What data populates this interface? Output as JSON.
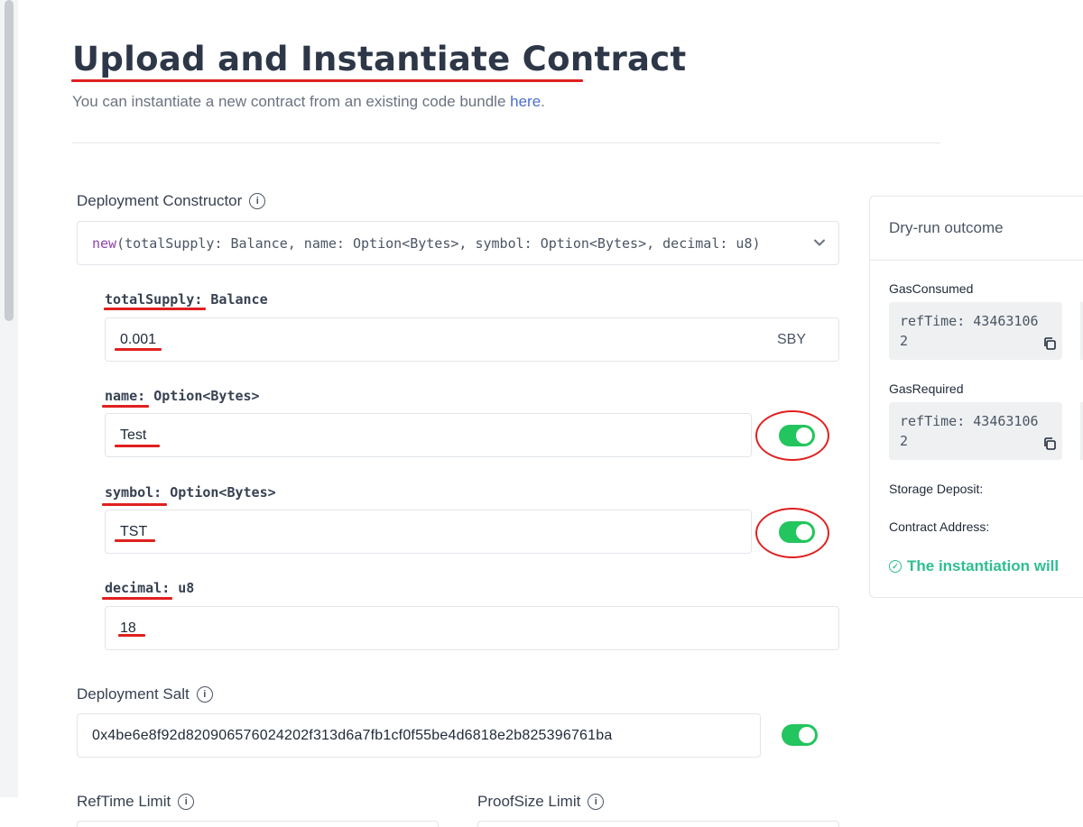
{
  "page": {
    "title": "Upload and Instantiate Contract",
    "subtitle_prefix": "You can instantiate a new contract from an existing code bundle ",
    "subtitle_link": "here",
    "subtitle_suffix": "."
  },
  "constructor": {
    "label": "Deployment Constructor",
    "selected_keyword": "new",
    "selected_signature": "(totalSupply: Balance, name: Option<Bytes>, symbol: Option<Bytes>, decimal: u8)"
  },
  "params": [
    {
      "name": "totalSupply:",
      "type": "Balance",
      "value": "0.001",
      "unit": "SBY"
    },
    {
      "name": "name:",
      "type": "Option<Bytes>",
      "value": "Test",
      "toggle_on": true
    },
    {
      "name": "symbol:",
      "type": "Option<Bytes>",
      "value": "TST",
      "toggle_on": true
    },
    {
      "name": "decimal:",
      "type": "u8",
      "value": "18"
    }
  ],
  "salt": {
    "label": "Deployment Salt",
    "value": "0x4be6e8f92d820906576024202f313d6a7fb1cf0f55be4d6818e2b825396761ba",
    "toggle_on": true
  },
  "limits": {
    "reftime_label": "RefTime Limit",
    "proofsize_label": "ProofSize Limit"
  },
  "dry_run": {
    "title": "Dry-run outcome",
    "gas_consumed_label": "GasConsumed",
    "gas_consumed_line1": "refTime: 43463106",
    "gas_consumed_line2": "2",
    "gas_required_label": "GasRequired",
    "gas_required_line1": "refTime: 43463106",
    "gas_required_line2": "2",
    "storage_deposit_label": "Storage Deposit:",
    "contract_address_label": "Contract Address:",
    "success_message": "The instantiation will"
  },
  "colors": {
    "annotation_red": "#e02020",
    "toggle_green": "#22c55e",
    "success_green": "#2ebf91",
    "link_blue": "#4c6fd1"
  },
  "icons": {
    "info": "info-circle-icon",
    "chevron": "chevron-down-icon",
    "copy": "copy-icon",
    "check": "check-circle-icon"
  }
}
